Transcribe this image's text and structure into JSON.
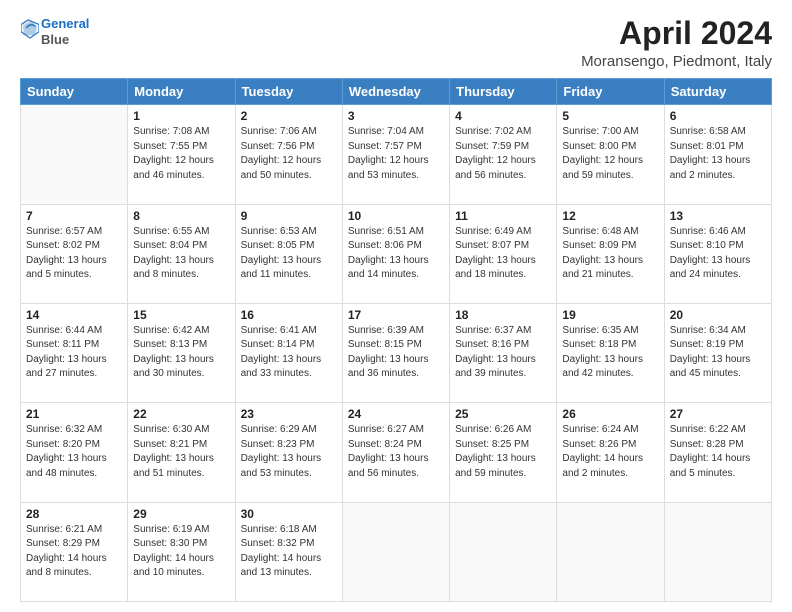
{
  "header": {
    "logo_line1": "General",
    "logo_line2": "Blue",
    "title": "April 2024",
    "subtitle": "Moransengo, Piedmont, Italy"
  },
  "days_of_week": [
    "Sunday",
    "Monday",
    "Tuesday",
    "Wednesday",
    "Thursday",
    "Friday",
    "Saturday"
  ],
  "weeks": [
    [
      {
        "day": "",
        "info": ""
      },
      {
        "day": "1",
        "info": "Sunrise: 7:08 AM\nSunset: 7:55 PM\nDaylight: 12 hours\nand 46 minutes."
      },
      {
        "day": "2",
        "info": "Sunrise: 7:06 AM\nSunset: 7:56 PM\nDaylight: 12 hours\nand 50 minutes."
      },
      {
        "day": "3",
        "info": "Sunrise: 7:04 AM\nSunset: 7:57 PM\nDaylight: 12 hours\nand 53 minutes."
      },
      {
        "day": "4",
        "info": "Sunrise: 7:02 AM\nSunset: 7:59 PM\nDaylight: 12 hours\nand 56 minutes."
      },
      {
        "day": "5",
        "info": "Sunrise: 7:00 AM\nSunset: 8:00 PM\nDaylight: 12 hours\nand 59 minutes."
      },
      {
        "day": "6",
        "info": "Sunrise: 6:58 AM\nSunset: 8:01 PM\nDaylight: 13 hours\nand 2 minutes."
      }
    ],
    [
      {
        "day": "7",
        "info": "Sunrise: 6:57 AM\nSunset: 8:02 PM\nDaylight: 13 hours\nand 5 minutes."
      },
      {
        "day": "8",
        "info": "Sunrise: 6:55 AM\nSunset: 8:04 PM\nDaylight: 13 hours\nand 8 minutes."
      },
      {
        "day": "9",
        "info": "Sunrise: 6:53 AM\nSunset: 8:05 PM\nDaylight: 13 hours\nand 11 minutes."
      },
      {
        "day": "10",
        "info": "Sunrise: 6:51 AM\nSunset: 8:06 PM\nDaylight: 13 hours\nand 14 minutes."
      },
      {
        "day": "11",
        "info": "Sunrise: 6:49 AM\nSunset: 8:07 PM\nDaylight: 13 hours\nand 18 minutes."
      },
      {
        "day": "12",
        "info": "Sunrise: 6:48 AM\nSunset: 8:09 PM\nDaylight: 13 hours\nand 21 minutes."
      },
      {
        "day": "13",
        "info": "Sunrise: 6:46 AM\nSunset: 8:10 PM\nDaylight: 13 hours\nand 24 minutes."
      }
    ],
    [
      {
        "day": "14",
        "info": "Sunrise: 6:44 AM\nSunset: 8:11 PM\nDaylight: 13 hours\nand 27 minutes."
      },
      {
        "day": "15",
        "info": "Sunrise: 6:42 AM\nSunset: 8:13 PM\nDaylight: 13 hours\nand 30 minutes."
      },
      {
        "day": "16",
        "info": "Sunrise: 6:41 AM\nSunset: 8:14 PM\nDaylight: 13 hours\nand 33 minutes."
      },
      {
        "day": "17",
        "info": "Sunrise: 6:39 AM\nSunset: 8:15 PM\nDaylight: 13 hours\nand 36 minutes."
      },
      {
        "day": "18",
        "info": "Sunrise: 6:37 AM\nSunset: 8:16 PM\nDaylight: 13 hours\nand 39 minutes."
      },
      {
        "day": "19",
        "info": "Sunrise: 6:35 AM\nSunset: 8:18 PM\nDaylight: 13 hours\nand 42 minutes."
      },
      {
        "day": "20",
        "info": "Sunrise: 6:34 AM\nSunset: 8:19 PM\nDaylight: 13 hours\nand 45 minutes."
      }
    ],
    [
      {
        "day": "21",
        "info": "Sunrise: 6:32 AM\nSunset: 8:20 PM\nDaylight: 13 hours\nand 48 minutes."
      },
      {
        "day": "22",
        "info": "Sunrise: 6:30 AM\nSunset: 8:21 PM\nDaylight: 13 hours\nand 51 minutes."
      },
      {
        "day": "23",
        "info": "Sunrise: 6:29 AM\nSunset: 8:23 PM\nDaylight: 13 hours\nand 53 minutes."
      },
      {
        "day": "24",
        "info": "Sunrise: 6:27 AM\nSunset: 8:24 PM\nDaylight: 13 hours\nand 56 minutes."
      },
      {
        "day": "25",
        "info": "Sunrise: 6:26 AM\nSunset: 8:25 PM\nDaylight: 13 hours\nand 59 minutes."
      },
      {
        "day": "26",
        "info": "Sunrise: 6:24 AM\nSunset: 8:26 PM\nDaylight: 14 hours\nand 2 minutes."
      },
      {
        "day": "27",
        "info": "Sunrise: 6:22 AM\nSunset: 8:28 PM\nDaylight: 14 hours\nand 5 minutes."
      }
    ],
    [
      {
        "day": "28",
        "info": "Sunrise: 6:21 AM\nSunset: 8:29 PM\nDaylight: 14 hours\nand 8 minutes."
      },
      {
        "day": "29",
        "info": "Sunrise: 6:19 AM\nSunset: 8:30 PM\nDaylight: 14 hours\nand 10 minutes."
      },
      {
        "day": "30",
        "info": "Sunrise: 6:18 AM\nSunset: 8:32 PM\nDaylight: 14 hours\nand 13 minutes."
      },
      {
        "day": "",
        "info": ""
      },
      {
        "day": "",
        "info": ""
      },
      {
        "day": "",
        "info": ""
      },
      {
        "day": "",
        "info": ""
      }
    ]
  ]
}
